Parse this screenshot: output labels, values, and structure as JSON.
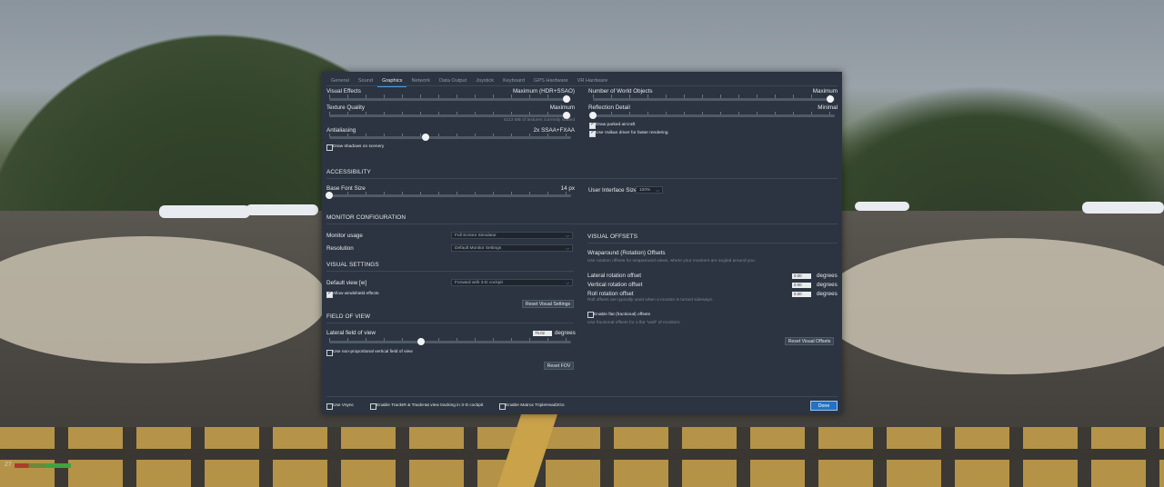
{
  "dialog": {
    "tabs": [
      "General",
      "Sound",
      "Graphics",
      "Network",
      "Data Output",
      "Joystick",
      "Keyboard",
      "GPS Hardware",
      "VR Hardware"
    ],
    "active_tab": "Graphics",
    "graphics": {
      "visual_effects": {
        "label": "Visual Effects",
        "value": "Maximum (HDR+SSAO)",
        "level": 0.98
      },
      "texture_quality": {
        "label": "Texture Quality",
        "value": "Maximum",
        "level": 0.98,
        "note": "5113 MB of textures currently loaded"
      },
      "antialiasing": {
        "label": "Antialiasing",
        "value": "2x SSAA+FXAA",
        "level": 0.4
      },
      "draw_shadows": {
        "label": "Draw shadows on scenery",
        "checked": false
      },
      "world_objects": {
        "label": "Number of World Objects",
        "value": "Maximum",
        "level": 0.98
      },
      "reflection_detail": {
        "label": "Reflection Detail",
        "value": "Minimal",
        "level": 0.0
      },
      "draw_parked_aircraft": {
        "label": "Draw parked aircraft",
        "checked": true
      },
      "use_vulkan": {
        "label": "Use Vulkan driver for faster rendering",
        "checked": true
      }
    },
    "accessibility": {
      "title": "ACCESSIBILITY",
      "base_font": {
        "label": "Base Font Size",
        "value": "14 px",
        "level": 0.0
      },
      "ui_size": {
        "label": "User Interface Size",
        "value": "100%"
      }
    },
    "monitor": {
      "title": "MONITOR CONFIGURATION",
      "usage": {
        "label": "Monitor usage",
        "value": "Full Screen Simulator"
      },
      "resolution": {
        "label": "Resolution",
        "value": "Default Monitor Settings"
      }
    },
    "visual_settings": {
      "title": "VISUAL SETTINGS",
      "default_view": {
        "label": "Default view [w]",
        "value": "Forward with 3-D cockpit"
      },
      "windshield": {
        "label": "Allow windshield effects",
        "checked": true
      },
      "reset_label": "Reset Visual Settings"
    },
    "fov": {
      "title": "FIELD OF VIEW",
      "lateral": {
        "label": "Lateral field of view",
        "value": "75.02",
        "unit": "degrees",
        "level": 0.38
      },
      "non_prop": {
        "label": "Use non-proportional vertical field of view",
        "checked": false
      },
      "reset_label": "Reset FOV"
    },
    "visual_offsets": {
      "title": "VISUAL OFFSETS",
      "wraparound_title": "Wraparound (Rotation) Offsets",
      "wraparound_sub": "Use rotation offsets for wraparound views, where your monitors are angled around you.",
      "lateral": {
        "label": "Lateral rotation offset",
        "value": "0.00",
        "unit": "degrees"
      },
      "vertical": {
        "label": "Vertical rotation offset",
        "value": "0.00",
        "unit": "degrees"
      },
      "roll": {
        "label": "Roll rotation offset",
        "value": "0.00",
        "unit": "degrees",
        "note": "Roll offsets are typically used when a monitor is turned sideways."
      },
      "flat": {
        "label": "Enable flat (fractional) offsets",
        "checked": false,
        "note": "Use fractional offsets for a flat \"wall\" of monitors."
      },
      "reset_label": "Reset Visual Offsets"
    },
    "footer": {
      "vsync": {
        "label": "Use Vsync",
        "checked": false
      },
      "trackir": {
        "label": "Enable TrackIR & TrackHat view tracking in 3-D cockpit",
        "checked": false
      },
      "matrox": {
        "label": "Enable Matrox TripleHead2Go",
        "checked": false
      },
      "done_label": "Done"
    }
  },
  "hud": {
    "fps": "27"
  },
  "colors": {
    "dialog_bg": "#2b3440",
    "accent": "#4a9fe0",
    "done_button": "#2571c4"
  }
}
